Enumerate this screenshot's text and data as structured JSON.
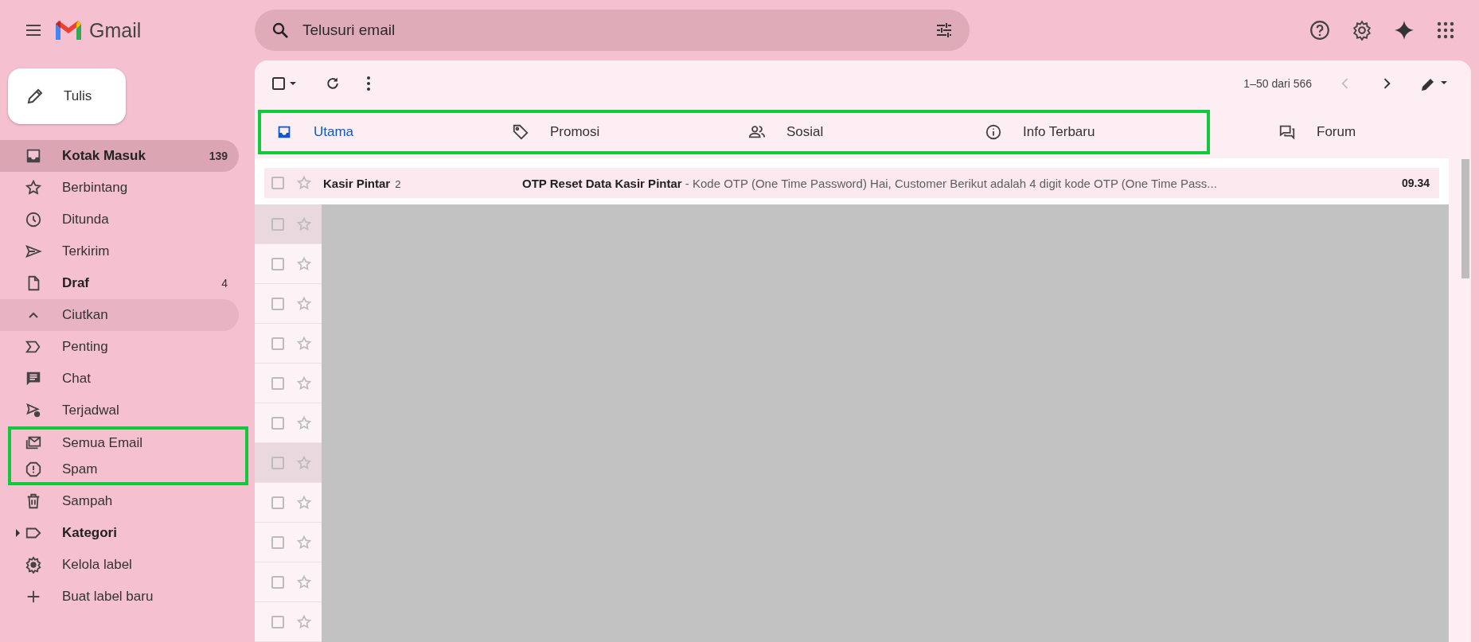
{
  "app": {
    "name": "Gmail"
  },
  "search": {
    "placeholder": "Telusuri email"
  },
  "compose": {
    "label": "Tulis"
  },
  "sidebar": {
    "items": [
      {
        "label": "Kotak Masuk",
        "count": "139",
        "bold": true,
        "selected": true,
        "highlighted": false,
        "outlined": false
      },
      {
        "label": "Berbintang",
        "bold": false,
        "selected": false,
        "highlighted": false,
        "outlined": false
      },
      {
        "label": "Ditunda",
        "bold": false,
        "selected": false,
        "highlighted": false,
        "outlined": false
      },
      {
        "label": "Terkirim",
        "bold": false,
        "selected": false,
        "highlighted": false,
        "outlined": false
      },
      {
        "label": "Draf",
        "count": "4",
        "bold": true,
        "selected": false,
        "highlighted": false,
        "outlined": false
      },
      {
        "label": "Ciutkan",
        "bold": false,
        "selected": false,
        "highlighted": true,
        "outlined": false
      },
      {
        "label": "Penting",
        "bold": false,
        "selected": false,
        "highlighted": false,
        "outlined": false
      },
      {
        "label": "Chat",
        "bold": false,
        "selected": false,
        "highlighted": false,
        "outlined": false
      },
      {
        "label": "Terjadwal",
        "bold": false,
        "selected": false,
        "highlighted": false,
        "outlined": false
      },
      {
        "label": "Semua Email",
        "bold": false,
        "selected": false,
        "highlighted": false,
        "outlined": true
      },
      {
        "label": "Spam",
        "bold": false,
        "selected": false,
        "highlighted": false,
        "outlined": true
      },
      {
        "label": "Sampah",
        "bold": false,
        "selected": false,
        "highlighted": false,
        "outlined": false
      },
      {
        "label": "Kategori",
        "bold": true,
        "selected": false,
        "highlighted": false,
        "outlined": false,
        "expanded": false
      },
      {
        "label": "Kelola label",
        "bold": false,
        "selected": false,
        "highlighted": false,
        "outlined": false
      },
      {
        "label": "Buat label baru",
        "bold": false,
        "selected": false,
        "highlighted": false,
        "outlined": false
      }
    ]
  },
  "toolbar": {
    "pagination": "1–50 dari 566",
    "select_all_checked": false
  },
  "tabs": [
    {
      "label": "Utama",
      "selected": true,
      "outlined": true
    },
    {
      "label": "Promosi",
      "selected": false,
      "outlined": true
    },
    {
      "label": "Sosial",
      "selected": false,
      "outlined": true
    },
    {
      "label": "Info Terbaru",
      "selected": false,
      "outlined": true
    },
    {
      "label": "Forum",
      "selected": false,
      "outlined": false
    }
  ],
  "emails": [
    {
      "sender": "Kasir Pintar",
      "thread_count": "2",
      "subject": "OTP Reset Data Kasir Pintar",
      "snippet": "- Kode OTP (One Time Password) Hai, Customer Berikut adalah 4 digit kode OTP (One Time Pass...",
      "time": "09.34",
      "unread": true
    }
  ],
  "hidden_rows": [
    {
      "highlighted": true
    },
    {
      "highlighted": false
    },
    {
      "highlighted": false
    },
    {
      "highlighted": false
    },
    {
      "highlighted": false
    },
    {
      "highlighted": false
    },
    {
      "highlighted": true
    },
    {
      "highlighted": false
    },
    {
      "highlighted": false
    },
    {
      "highlighted": false
    },
    {
      "highlighted": false
    }
  ]
}
